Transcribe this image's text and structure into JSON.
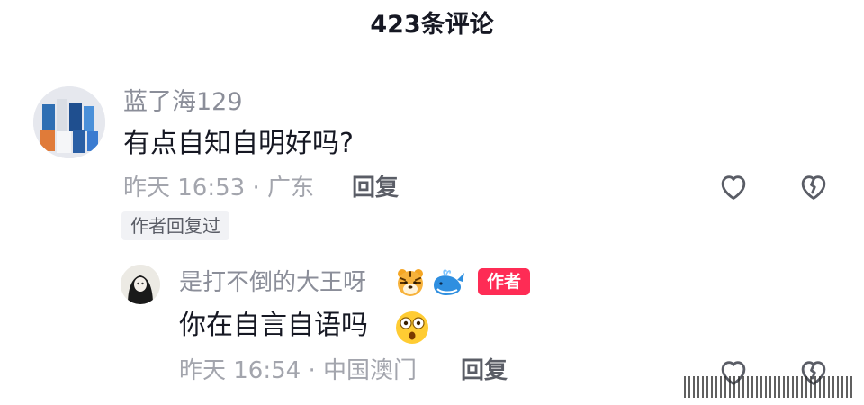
{
  "header": {
    "title": "423条评论"
  },
  "comment": {
    "username": "蓝了海129",
    "text": "有点自知自明好吗?",
    "time_location": "昨天 16:53 · 广东",
    "reply_label": "回复",
    "author_replied": "作者回复过",
    "icons": {
      "like": "heart-outline-icon",
      "dislike": "broken-heart-icon"
    }
  },
  "reply": {
    "username": "是打不倒的大王呀",
    "emojis": [
      "tiger-face-emoji",
      "whale-emoji"
    ],
    "author_badge": "作者",
    "text": "你在自言自语吗",
    "text_emoji": "astonished-face-emoji",
    "time_location": "昨天 16:54 · 中国澳门",
    "reply_label": "回复"
  },
  "colors": {
    "accent": "#fe2c55",
    "text": "#161823",
    "muted": "#a3a5ad"
  }
}
